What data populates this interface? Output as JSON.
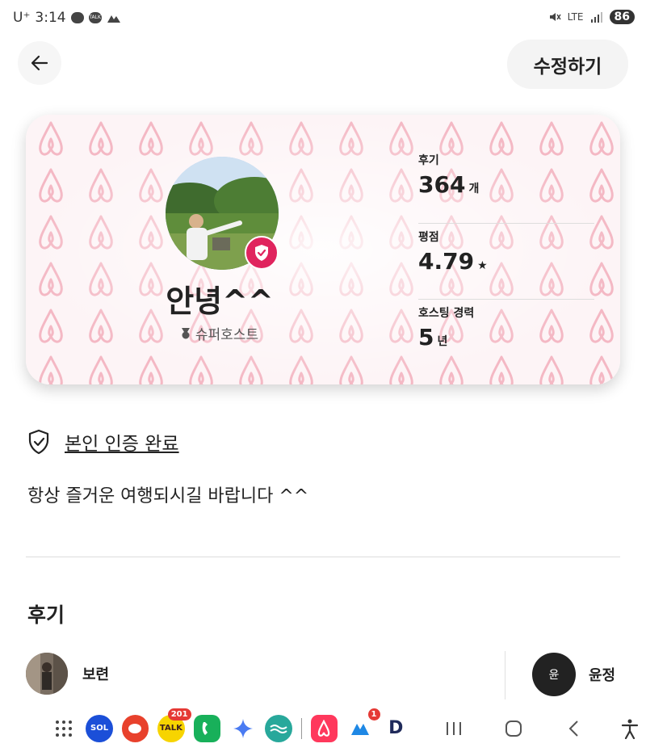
{
  "status_bar": {
    "carrier": "U⁺",
    "time": "3:14",
    "network": "LTE",
    "battery": "86"
  },
  "header": {
    "edit_label": "수정하기"
  },
  "profile": {
    "name": "안녕^^",
    "badge": "슈퍼호스트",
    "stats": [
      {
        "label": "후기",
        "value": "364",
        "unit": "개"
      },
      {
        "label": "평점",
        "value": "4.79",
        "unit": "★"
      },
      {
        "label": "호스팅 경력",
        "value": "5",
        "unit": "년"
      }
    ]
  },
  "verification": {
    "label": "본인 인증 완료"
  },
  "intro": "항상 즐거운 여행되시길 바랍니다 ^^",
  "reviews": {
    "title": "후기",
    "items": [
      {
        "name": "보련"
      },
      {
        "name": "윤정",
        "initial": "윤"
      }
    ]
  },
  "taskbar": {
    "apps": [
      {
        "name": "apps-grid",
        "color": "#ffffff"
      },
      {
        "name": "sol-bank",
        "label": "SOL",
        "color": "#1b4fd8"
      },
      {
        "name": "chat",
        "color": "#e8412c"
      },
      {
        "name": "kakaotalk",
        "label": "TALK",
        "color": "#f7d400",
        "count": "201"
      },
      {
        "name": "phone",
        "color": "#18b05a"
      },
      {
        "name": "gemini",
        "color": "#ffffff"
      },
      {
        "name": "wave",
        "color": "#28a89b"
      },
      {
        "name": "airbnb",
        "color": "#ff385c"
      },
      {
        "name": "m-app",
        "color": "#ffffff",
        "count": "1"
      },
      {
        "name": "d-app",
        "label": "D",
        "color": "#ffffff"
      }
    ]
  }
}
